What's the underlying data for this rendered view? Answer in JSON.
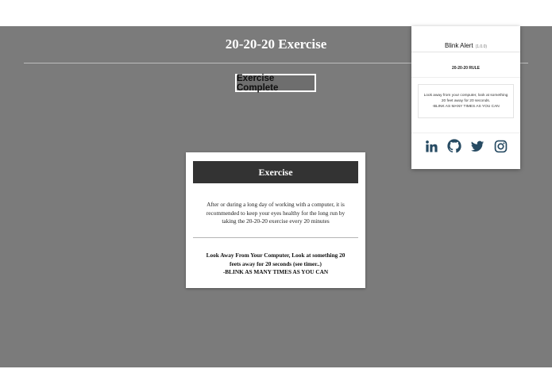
{
  "page": {
    "title": "20-20-20 Exercise",
    "complete_button": "Exercise Complete",
    "background_color": "#7b7b7b"
  },
  "card": {
    "header": "Exercise",
    "description": "After or during a long day of working with a computer, it is recommended to keep your eyes healthy for the long run by taking the 20-20-20 exercise every 20 minutes",
    "instruction_line1": "Look Away From Your Computer, Look at something 20 feets away for 20 seconds (see timer..)",
    "instruction_line2": "-BLINK AS MANY TIMES AS YOU CAN"
  },
  "popup": {
    "name": "Blink Alert",
    "version": "(1.0.0)",
    "subtitle": "20-20-20 RULE",
    "message_line1": "Look away from your computer, look at something 20 feet away for 20 seconds.",
    "message_line2": "-BLINK AS MANY TIMES AS YOU CAN",
    "icon_color": "#274b63",
    "social": [
      "linkedin-icon",
      "github-icon",
      "twitter-icon",
      "instagram-icon"
    ]
  }
}
